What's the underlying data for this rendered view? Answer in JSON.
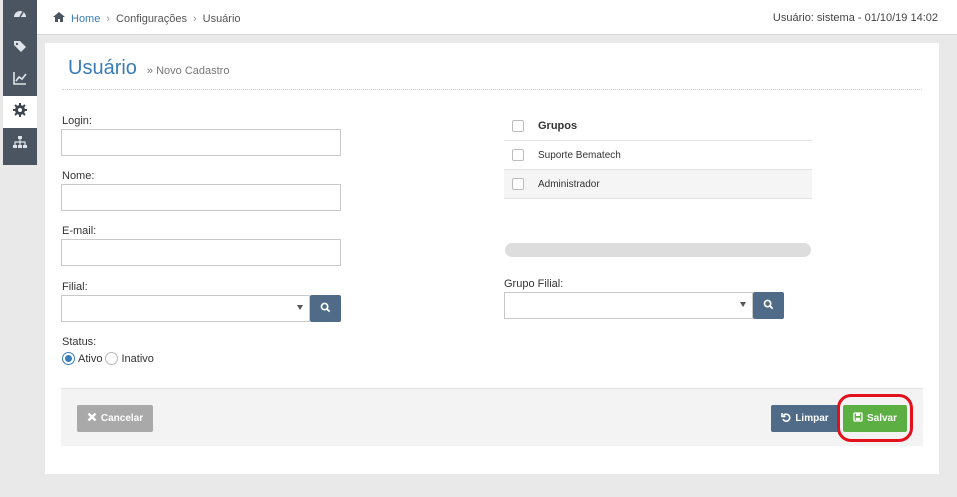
{
  "sidebar": {
    "items": [
      {
        "icon": "dashboard-icon",
        "active": false
      },
      {
        "icon": "tag-icon",
        "active": false
      },
      {
        "icon": "chart-icon",
        "active": false
      },
      {
        "icon": "gear-icon",
        "active": true
      },
      {
        "icon": "sitemap-icon",
        "active": false
      }
    ]
  },
  "header": {
    "breadcrumb": {
      "home": "Home",
      "section": "Configurações",
      "page": "Usuário"
    },
    "user_info": "Usuário: sistema - 01/10/19 14:02"
  },
  "form": {
    "title": "Usuário",
    "subtitle": "» Novo Cadastro",
    "login": {
      "label": "Login:",
      "value": ""
    },
    "nome": {
      "label": "Nome:",
      "value": ""
    },
    "email": {
      "label": "E-mail:",
      "value": ""
    },
    "filial": {
      "label": "Filial:",
      "value": ""
    },
    "status": {
      "label": "Status:",
      "options": [
        "Ativo",
        "Inativo"
      ],
      "selected": "Ativo"
    },
    "groups": {
      "header": "Grupos",
      "items": [
        "Suporte Bematech",
        "Administrador"
      ]
    },
    "grupo_filial": {
      "label": "Grupo Filial:",
      "value": ""
    }
  },
  "actions": {
    "cancel": "Cancelar",
    "clear": "Limpar",
    "save": "Salvar"
  },
  "colors": {
    "accent": "#3a7db5",
    "sidebar": "#4b5562",
    "save": "#5cb043",
    "secondary": "#4f6b87",
    "highlight": "#e2111b"
  }
}
